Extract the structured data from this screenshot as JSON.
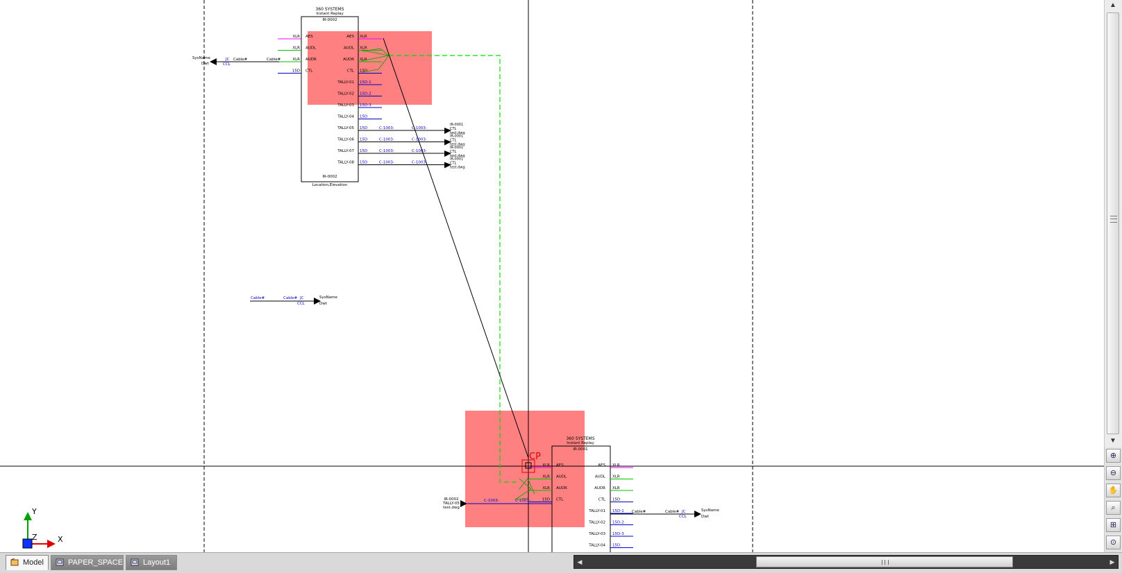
{
  "tabs": [
    {
      "label": "Model",
      "active": true
    },
    {
      "label": "PAPER_SPACE",
      "active": false
    },
    {
      "label": "Layout1",
      "active": false
    }
  ],
  "ucs": {
    "x_label": "X",
    "y_label": "Y",
    "z_label": "Z"
  },
  "colors": {
    "highlight": "#ff8080",
    "magenta": "#ff00ff",
    "green": "#00c000",
    "blue": "#0000c8",
    "dashed_path": "#00dd00",
    "crosshair": "#000000",
    "cursor_red": "#e00000"
  },
  "cursor_label": "CP",
  "navbar_icons": [
    "zoom-in-icon",
    "zoom-out-icon",
    "pan-hand-icon",
    "zoom-window-icon",
    "zoom-extents-icon",
    "zoom-realtime-icon"
  ],
  "device_top": {
    "header1": "360 SYSTEMS",
    "header2": "Instant Replay",
    "id": "IR-0002",
    "footer_id": "IR-0002",
    "location": "Location,Elevation",
    "left_ports": [
      "AES",
      "AUDL",
      "AUDR",
      "CTL"
    ],
    "right_ports": [
      "AES",
      "AUDL",
      "AUDR",
      "CTL",
      "TALLY-01",
      "TALLY-02",
      "TALLY-03",
      "TALLY-04",
      "TALLY-05",
      "TALLY-06",
      "TALLY-07",
      "TALLY-08"
    ],
    "left_conn": [
      "XLR",
      "XLR",
      "XLR",
      "15D"
    ],
    "right_conn": [
      "XLR",
      "XLR",
      "XLR",
      "15D",
      "15D-1",
      "15D-2",
      "15D-3",
      "15D",
      "15D",
      "15D",
      "15D",
      "15D"
    ],
    "cable_a": "C-1003-",
    "cable_b": "C-1003-",
    "dest1": "IR-0001",
    "dest2": "CTL",
    "dest3": "test.dwg"
  },
  "device_bottom": {
    "header1": "360 SYSTEMS",
    "header2": "Instant Replay",
    "id": "IR-0001",
    "left_ports": [
      "AES",
      "AUDL",
      "AUDR",
      "CTL"
    ],
    "right_ports": [
      "AES",
      "AUDL",
      "AUDR",
      "CTL",
      "TALLY-01",
      "TALLY-02",
      "TALLY-03",
      "TALLY-04"
    ],
    "left_conn": [
      "XLR",
      "XLR",
      "XLR",
      "15D"
    ],
    "right_conn": [
      "XLR",
      "XLR",
      "XLR",
      "15D",
      "15D-1",
      "15D-2",
      "15D-3",
      "15D"
    ],
    "in_src1": "IR-0002",
    "in_src2": "TALLY-05",
    "in_src3": "test.dwg",
    "in_cable": "C-1003-",
    "in_cable2": "C-1003-",
    "out_cable1": "Cable#",
    "out_cable2": "Cable#",
    "out_jc": "JC",
    "out_ccl": "CCL",
    "out_sys1": "SysName",
    "out_sys2": "Dwt"
  },
  "tag_top_left": {
    "sys1": "SysName",
    "sys2": "Dwt",
    "jc": "JC",
    "ccl": "CCL",
    "cable1": "Cable#",
    "cable2": "Cable#"
  },
  "tag_mid_left": {
    "cable1": "Cable#",
    "cable2": "Cable#",
    "jc": "JC",
    "ccl": "CCL",
    "sys1": "SysName",
    "sys2": "Dwt"
  }
}
